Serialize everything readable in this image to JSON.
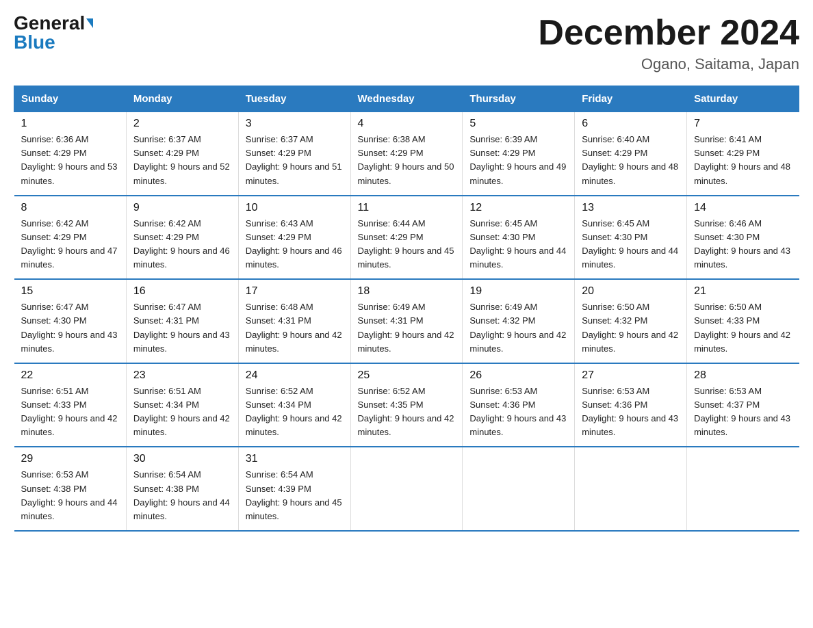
{
  "header": {
    "logo_general": "General",
    "logo_blue": "Blue",
    "month_title": "December 2024",
    "location": "Ogano, Saitama, Japan"
  },
  "days_of_week": [
    "Sunday",
    "Monday",
    "Tuesday",
    "Wednesday",
    "Thursday",
    "Friday",
    "Saturday"
  ],
  "weeks": [
    [
      {
        "num": "1",
        "sunrise": "6:36 AM",
        "sunset": "4:29 PM",
        "daylight": "9 hours and 53 minutes."
      },
      {
        "num": "2",
        "sunrise": "6:37 AM",
        "sunset": "4:29 PM",
        "daylight": "9 hours and 52 minutes."
      },
      {
        "num": "3",
        "sunrise": "6:37 AM",
        "sunset": "4:29 PM",
        "daylight": "9 hours and 51 minutes."
      },
      {
        "num": "4",
        "sunrise": "6:38 AM",
        "sunset": "4:29 PM",
        "daylight": "9 hours and 50 minutes."
      },
      {
        "num": "5",
        "sunrise": "6:39 AM",
        "sunset": "4:29 PM",
        "daylight": "9 hours and 49 minutes."
      },
      {
        "num": "6",
        "sunrise": "6:40 AM",
        "sunset": "4:29 PM",
        "daylight": "9 hours and 48 minutes."
      },
      {
        "num": "7",
        "sunrise": "6:41 AM",
        "sunset": "4:29 PM",
        "daylight": "9 hours and 48 minutes."
      }
    ],
    [
      {
        "num": "8",
        "sunrise": "6:42 AM",
        "sunset": "4:29 PM",
        "daylight": "9 hours and 47 minutes."
      },
      {
        "num": "9",
        "sunrise": "6:42 AM",
        "sunset": "4:29 PM",
        "daylight": "9 hours and 46 minutes."
      },
      {
        "num": "10",
        "sunrise": "6:43 AM",
        "sunset": "4:29 PM",
        "daylight": "9 hours and 46 minutes."
      },
      {
        "num": "11",
        "sunrise": "6:44 AM",
        "sunset": "4:29 PM",
        "daylight": "9 hours and 45 minutes."
      },
      {
        "num": "12",
        "sunrise": "6:45 AM",
        "sunset": "4:30 PM",
        "daylight": "9 hours and 44 minutes."
      },
      {
        "num": "13",
        "sunrise": "6:45 AM",
        "sunset": "4:30 PM",
        "daylight": "9 hours and 44 minutes."
      },
      {
        "num": "14",
        "sunrise": "6:46 AM",
        "sunset": "4:30 PM",
        "daylight": "9 hours and 43 minutes."
      }
    ],
    [
      {
        "num": "15",
        "sunrise": "6:47 AM",
        "sunset": "4:30 PM",
        "daylight": "9 hours and 43 minutes."
      },
      {
        "num": "16",
        "sunrise": "6:47 AM",
        "sunset": "4:31 PM",
        "daylight": "9 hours and 43 minutes."
      },
      {
        "num": "17",
        "sunrise": "6:48 AM",
        "sunset": "4:31 PM",
        "daylight": "9 hours and 42 minutes."
      },
      {
        "num": "18",
        "sunrise": "6:49 AM",
        "sunset": "4:31 PM",
        "daylight": "9 hours and 42 minutes."
      },
      {
        "num": "19",
        "sunrise": "6:49 AM",
        "sunset": "4:32 PM",
        "daylight": "9 hours and 42 minutes."
      },
      {
        "num": "20",
        "sunrise": "6:50 AM",
        "sunset": "4:32 PM",
        "daylight": "9 hours and 42 minutes."
      },
      {
        "num": "21",
        "sunrise": "6:50 AM",
        "sunset": "4:33 PM",
        "daylight": "9 hours and 42 minutes."
      }
    ],
    [
      {
        "num": "22",
        "sunrise": "6:51 AM",
        "sunset": "4:33 PM",
        "daylight": "9 hours and 42 minutes."
      },
      {
        "num": "23",
        "sunrise": "6:51 AM",
        "sunset": "4:34 PM",
        "daylight": "9 hours and 42 minutes."
      },
      {
        "num": "24",
        "sunrise": "6:52 AM",
        "sunset": "4:34 PM",
        "daylight": "9 hours and 42 minutes."
      },
      {
        "num": "25",
        "sunrise": "6:52 AM",
        "sunset": "4:35 PM",
        "daylight": "9 hours and 42 minutes."
      },
      {
        "num": "26",
        "sunrise": "6:53 AM",
        "sunset": "4:36 PM",
        "daylight": "9 hours and 43 minutes."
      },
      {
        "num": "27",
        "sunrise": "6:53 AM",
        "sunset": "4:36 PM",
        "daylight": "9 hours and 43 minutes."
      },
      {
        "num": "28",
        "sunrise": "6:53 AM",
        "sunset": "4:37 PM",
        "daylight": "9 hours and 43 minutes."
      }
    ],
    [
      {
        "num": "29",
        "sunrise": "6:53 AM",
        "sunset": "4:38 PM",
        "daylight": "9 hours and 44 minutes."
      },
      {
        "num": "30",
        "sunrise": "6:54 AM",
        "sunset": "4:38 PM",
        "daylight": "9 hours and 44 minutes."
      },
      {
        "num": "31",
        "sunrise": "6:54 AM",
        "sunset": "4:39 PM",
        "daylight": "9 hours and 45 minutes."
      },
      null,
      null,
      null,
      null
    ]
  ]
}
